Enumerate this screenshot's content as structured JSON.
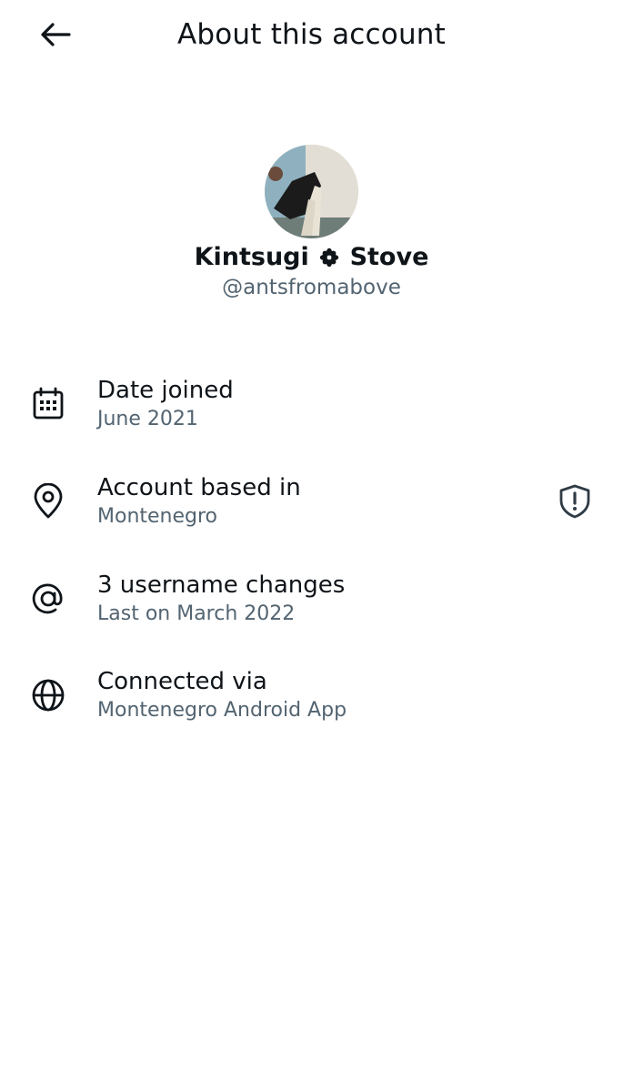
{
  "header": {
    "title": "About this account",
    "back_icon": "arrow-left-icon"
  },
  "profile": {
    "display_name_first": "Kintsugi",
    "display_name_emoji_icon": "flower-icon",
    "display_name_last": "Stove",
    "handle": "@antsfromabove"
  },
  "details": [
    {
      "icon": "calendar-icon",
      "title": "Date joined",
      "value": "June 2021"
    },
    {
      "icon": "location-pin-icon",
      "title": "Account based in",
      "value": "Montenegro",
      "action_icon": "shield-alert-icon"
    },
    {
      "icon": "at-sign-icon",
      "title": "3 username changes",
      "value": "Last on March 2022"
    },
    {
      "icon": "globe-icon",
      "title": "Connected via",
      "value": "Montenegro Android App"
    }
  ],
  "colors": {
    "text_primary": "#0f1419",
    "text_secondary": "#536471",
    "background": "#ffffff"
  }
}
